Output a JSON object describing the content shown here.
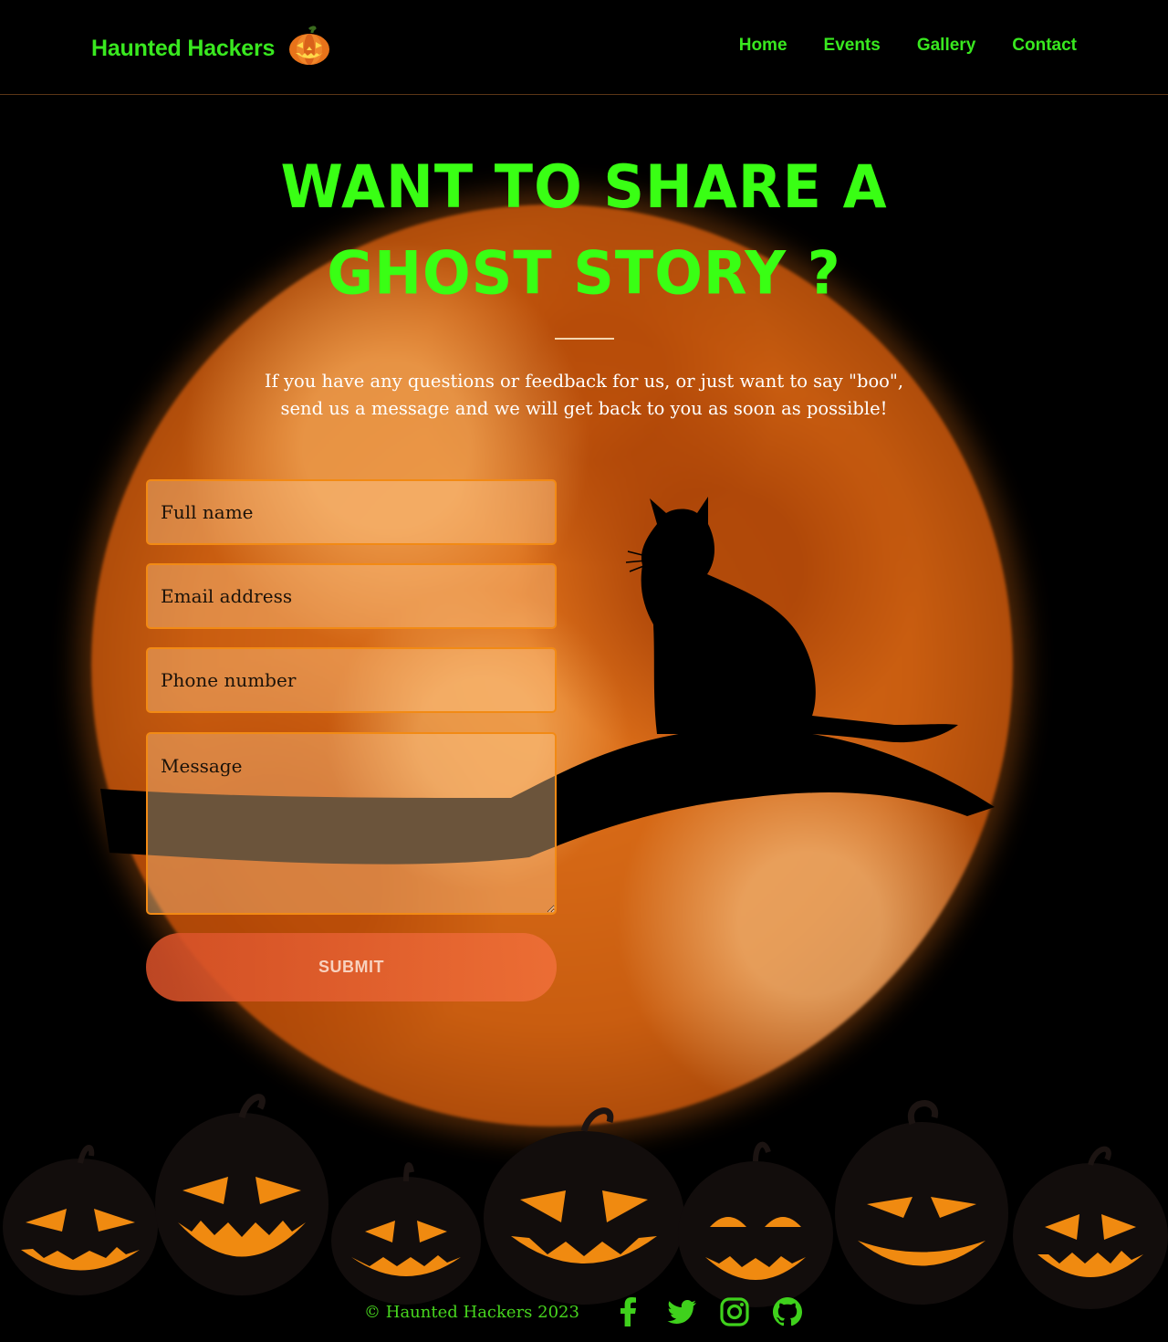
{
  "brand": {
    "name": "Haunted Hackers",
    "icon": "jack-o-lantern-icon"
  },
  "nav": {
    "items": [
      "Home",
      "Events",
      "Gallery",
      "Contact"
    ]
  },
  "hero": {
    "title": "Want to share a ghost story ?",
    "intro_line1": "If you have any questions or feedback for us, or just want to say \"boo\",",
    "intro_line2": "send us a message and we will get back to you as soon as possible!"
  },
  "form": {
    "name_placeholder": "Full name",
    "email_placeholder": "Email address",
    "phone_placeholder": "Phone number",
    "message_placeholder": "Message",
    "submit_label": "SUBMIT"
  },
  "footer": {
    "copyright": "© Haunted Hackers 2023",
    "social": [
      "facebook-icon",
      "twitter-icon",
      "instagram-icon",
      "github-icon"
    ]
  },
  "colors": {
    "accent_green": "#39e81f",
    "moon_orange": "#d9691a",
    "field_border": "#f28a14",
    "button": "#e0653a"
  }
}
